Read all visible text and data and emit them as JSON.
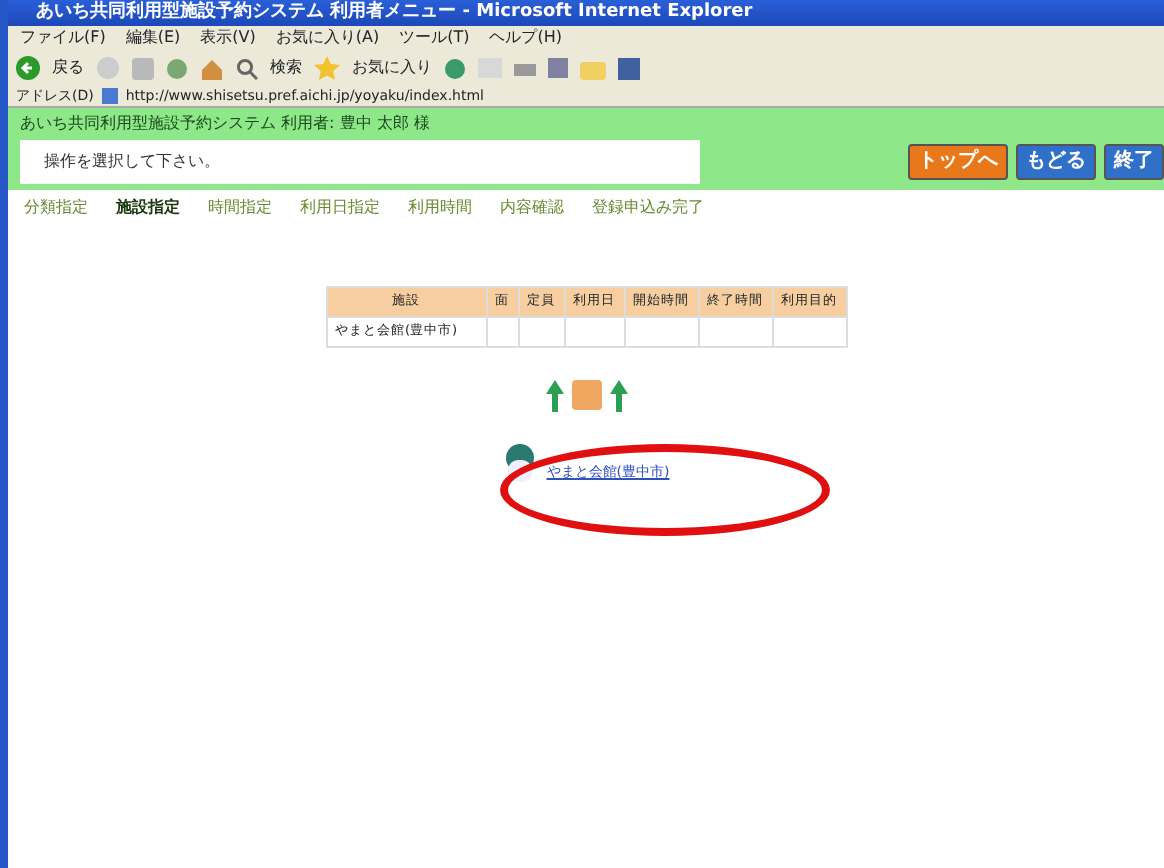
{
  "window": {
    "title": "あいち共同利用型施設予約システム 利用者メニュー - Microsoft Internet Explorer"
  },
  "menu_bar": [
    "ファイル(F)",
    "編集(E)",
    "表示(V)",
    "お気に入り(A)",
    "ツール(T)",
    "ヘルプ(H)"
  ],
  "toolbar": {
    "back": "戻る",
    "search": "検索",
    "favorites": "お気に入り"
  },
  "address_bar": {
    "label": "アドレス(D)",
    "url": "http://www.shisetsu.pref.aichi.jp/yoyaku/index.html"
  },
  "header": {
    "title": "あいち共同利用型施設予約システム 利用者: 豊中 太郎 様",
    "message": "操作を選択して下さい。",
    "buttons": [
      {
        "label": "トップへ",
        "kind": "orange"
      },
      {
        "label": "もどる",
        "kind": "blue"
      },
      {
        "label": "終了",
        "kind": "blue"
      }
    ]
  },
  "steps": [
    {
      "label": "分類指定",
      "selected": false
    },
    {
      "label": "施設指定",
      "selected": true
    },
    {
      "label": "時間指定",
      "selected": false
    },
    {
      "label": "利用日指定",
      "selected": false
    },
    {
      "label": "利用時間",
      "selected": false
    },
    {
      "label": "内容確認",
      "selected": false
    },
    {
      "label": "登録申込み完了",
      "selected": false
    }
  ],
  "table": {
    "columns": [
      "施設",
      "面",
      "定員",
      "利用日",
      "開始時間",
      "終了時間",
      "利用目的"
    ],
    "rows": [
      [
        "やまと会館(豊中市)",
        "",
        "",
        "",
        "",
        "",
        ""
      ]
    ]
  },
  "facility_link": "やまと会館(豊中市)"
}
